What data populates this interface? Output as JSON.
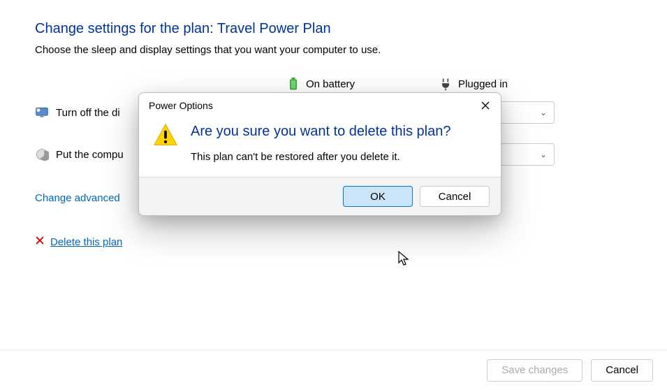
{
  "header": {
    "title": "Change settings for the plan: Travel Power Plan",
    "subtitle": "Choose the sleep and display settings that you want your computer to use."
  },
  "columns": {
    "battery": "On battery",
    "plugged": "Plugged in"
  },
  "settings": {
    "display": {
      "label_partial": "Turn off the di"
    },
    "sleep": {
      "label_partial": "Put the compu"
    }
  },
  "links": {
    "advanced": "Change advanced",
    "delete": "Delete this plan"
  },
  "footer": {
    "save": "Save changes",
    "cancel": "Cancel"
  },
  "modal": {
    "title": "Power Options",
    "heading": "Are you sure you want to delete this plan?",
    "body": "This plan can't be restored after you delete it.",
    "ok": "OK",
    "cancel": "Cancel"
  }
}
